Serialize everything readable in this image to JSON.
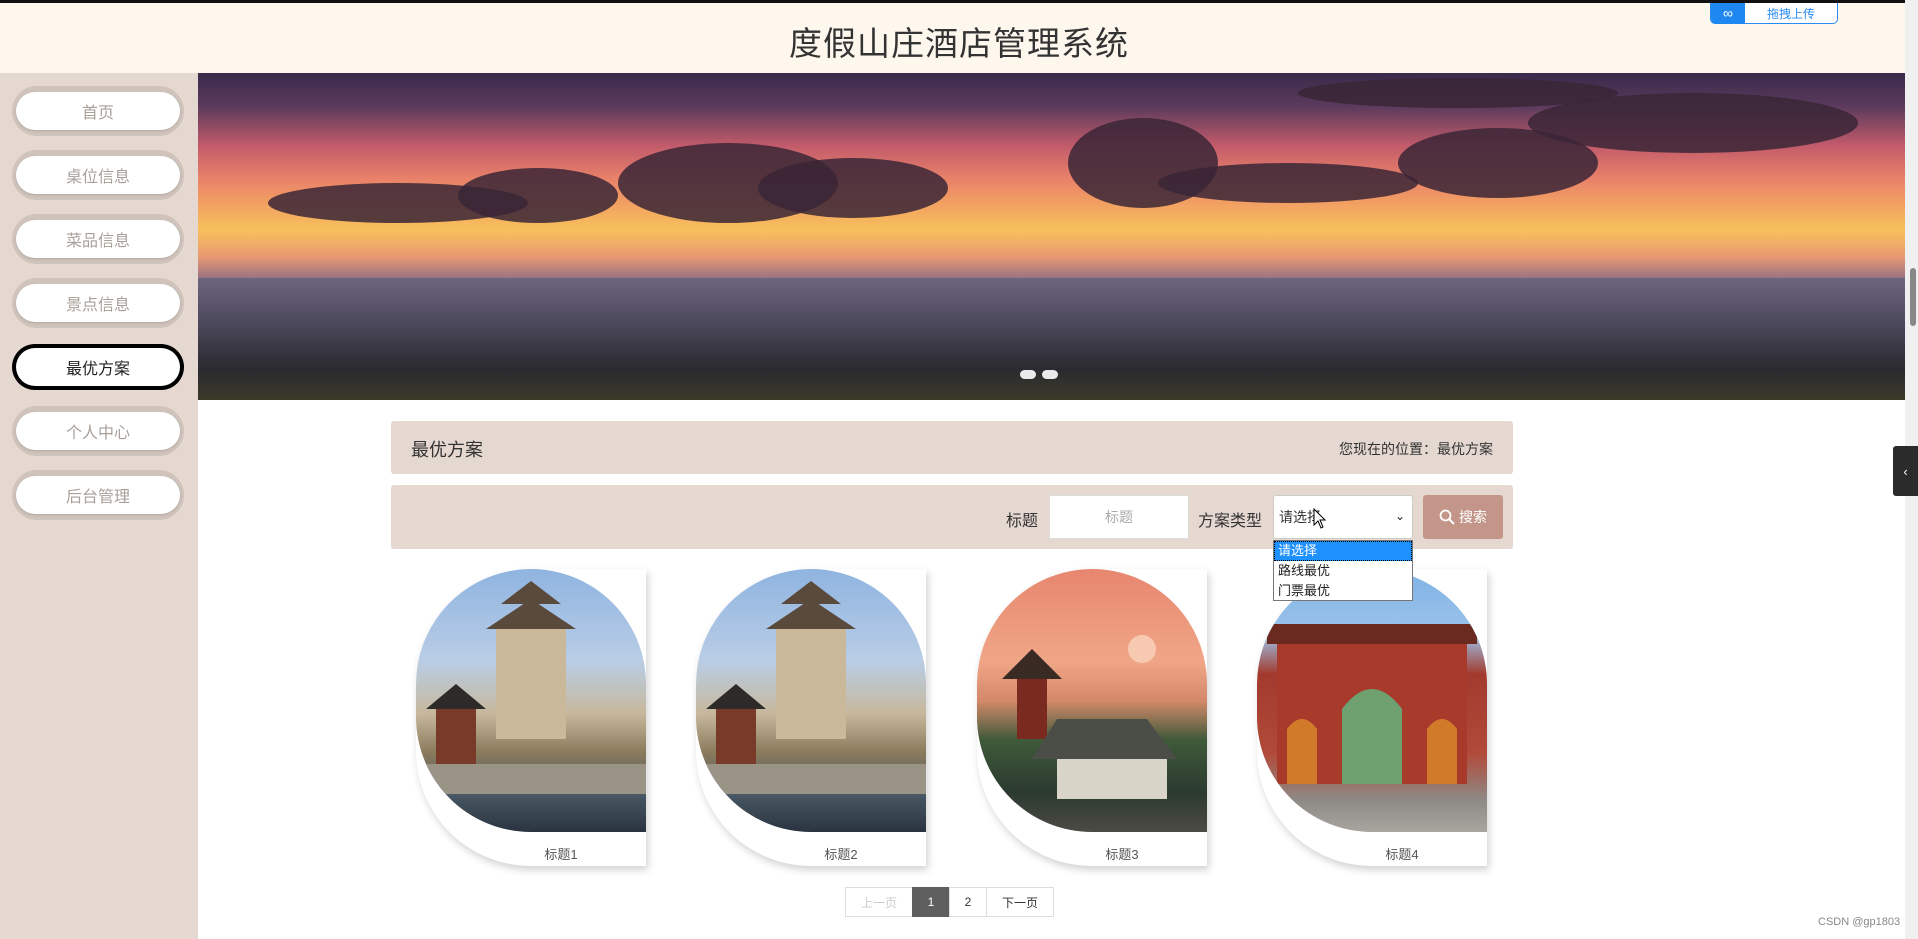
{
  "header": {
    "title": "度假山庄酒店管理系统"
  },
  "upload": {
    "label": "拖拽上传",
    "icon": "link-icon"
  },
  "sidebar": {
    "items": [
      {
        "label": "首页",
        "active": false
      },
      {
        "label": "桌位信息",
        "active": false
      },
      {
        "label": "菜品信息",
        "active": false
      },
      {
        "label": "景点信息",
        "active": false
      },
      {
        "label": "最优方案",
        "active": true
      },
      {
        "label": "个人中心",
        "active": false
      },
      {
        "label": "后台管理",
        "active": false
      }
    ]
  },
  "banner": {
    "slides": 2,
    "active_slide": 1
  },
  "breadcrumb": {
    "page_title": "最优方案",
    "location": "您现在的位置：最优方案"
  },
  "search": {
    "title_label": "标题",
    "title_placeholder": "标题",
    "type_label": "方案类型",
    "type_value": "请选择",
    "button_label": "搜索",
    "button_icon": "search-icon",
    "options": [
      "请选择",
      "路线最优",
      "门票最优"
    ],
    "selected_option": "请选择"
  },
  "cards": [
    {
      "caption": "标题1",
      "image": "pagoda-lake-photo"
    },
    {
      "caption": "标题2",
      "image": "pagoda-lake-photo"
    },
    {
      "caption": "标题3",
      "image": "pavilion-sunset-photo"
    },
    {
      "caption": "标题4",
      "image": "red-gate-photo"
    }
  ],
  "pagination": {
    "prev": "上一页",
    "pages": [
      "1",
      "2"
    ],
    "current": "1",
    "next": "下一页"
  },
  "watermark": "CSDN @gp1803",
  "colors": {
    "sidebar_bg": "#e5d8d0",
    "header_bg": "#fdf7ee",
    "button": "#c4968a",
    "current_page": "#5f5f5f"
  }
}
